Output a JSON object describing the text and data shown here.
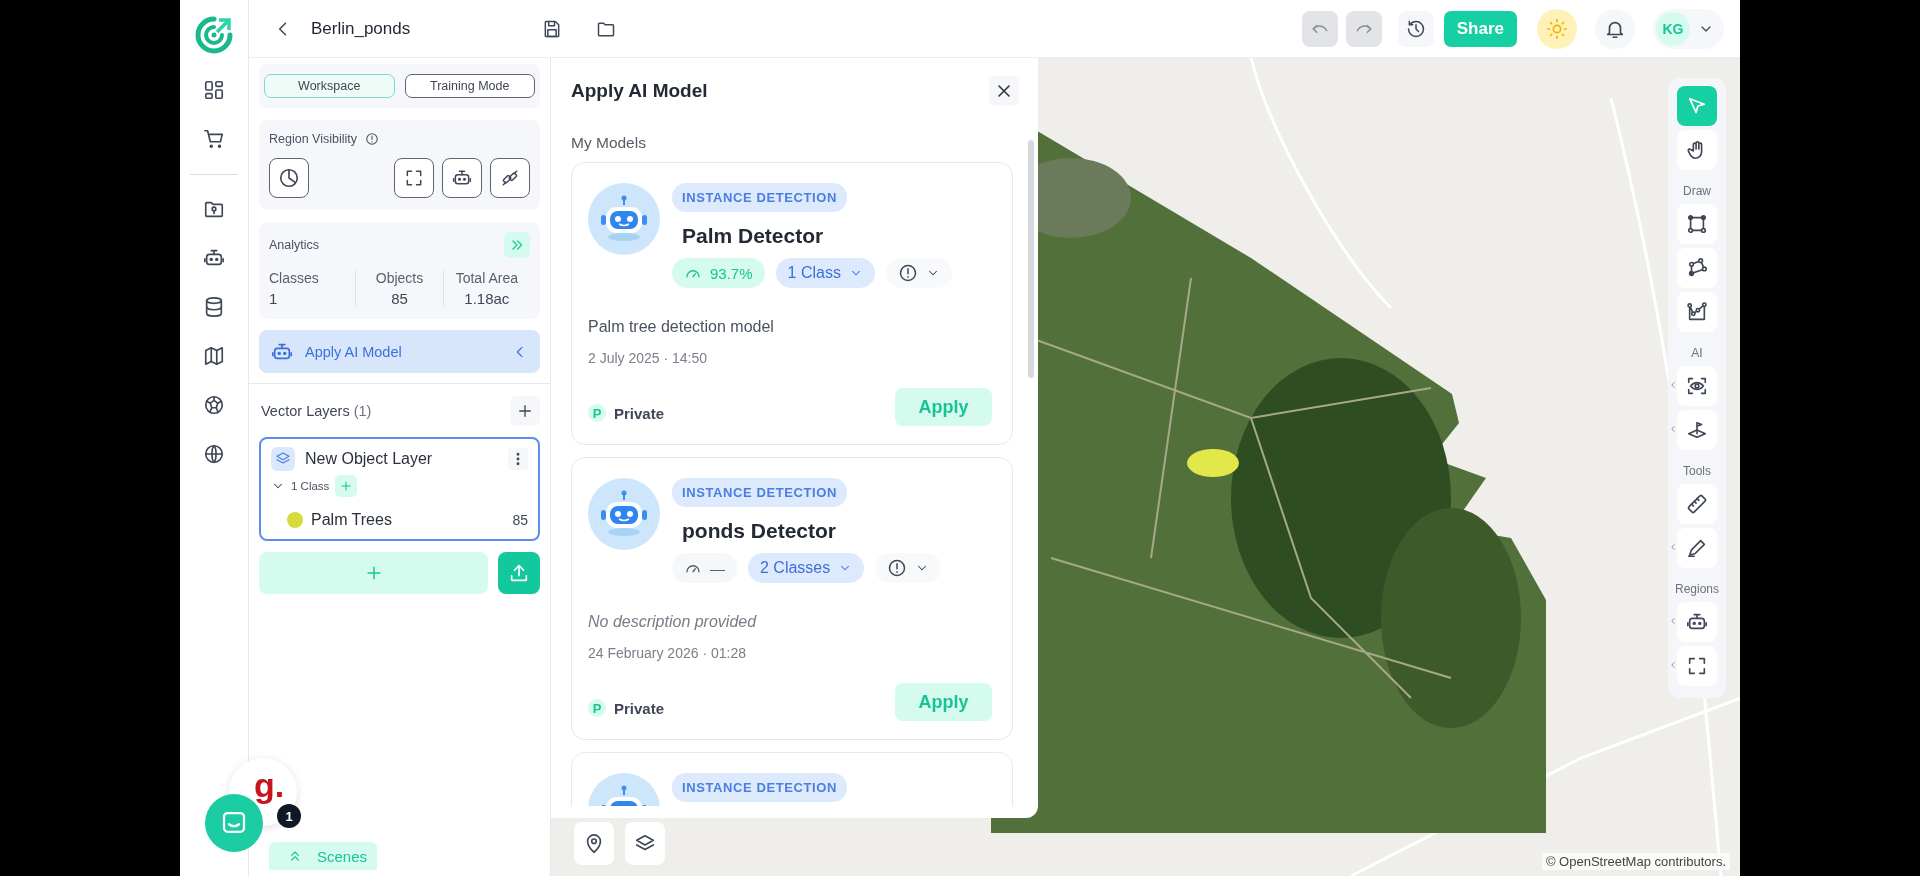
{
  "top_bar": {
    "project_title": "Berlin_ponds",
    "undo": {
      "disabled": true
    },
    "redo": {
      "disabled": true
    },
    "share_label": "Share",
    "user_initials": "KG"
  },
  "side_panel": {
    "modes": [
      {
        "label": "Workspace",
        "selected": true
      },
      {
        "label": "Training Mode",
        "selected": false
      }
    ],
    "region_visibility": {
      "title": "Region Visibility"
    },
    "analytics": {
      "title": "Analytics",
      "stats": [
        {
          "label": "Classes",
          "value": "1"
        },
        {
          "label": "Objects",
          "value": "85"
        },
        {
          "label": "Total Area",
          "value": "1.18ac"
        }
      ]
    },
    "apply_ai_model": {
      "label": "Apply AI Model",
      "selected": true
    },
    "vector_layers": {
      "title": "Vector Layers",
      "count": "(1)",
      "layers": [
        {
          "name": "New Object Layer",
          "selected": true,
          "class_count": "1 Class",
          "expanded": true,
          "classes": [
            {
              "name": "Palm Trees",
              "count": "85",
              "color": "#d6dc3c"
            }
          ]
        }
      ]
    },
    "scenes_label": "Scenes"
  },
  "chat_widget": {
    "logo_text": "g.",
    "badge": "1"
  },
  "models_panel": {
    "title": "Apply AI Model",
    "section_title": "My Models",
    "models": [
      {
        "type": "INSTANCE DETECTION",
        "name": "Palm Detector",
        "accuracy": "93.7%",
        "accuracy_known": true,
        "classes": "1 Class",
        "description": "Palm tree detection model",
        "description_missing": false,
        "date": "2 July 2025 · 14:50",
        "visibility_initial": "P",
        "visibility": "Private",
        "apply_label": "Apply"
      },
      {
        "type": "INSTANCE DETECTION",
        "name": "ponds Detector",
        "accuracy": "—",
        "accuracy_known": false,
        "classes": "2 Classes",
        "description": "No description provided",
        "description_missing": true,
        "date": "24 February 2026 · 01:28",
        "visibility_initial": "P",
        "visibility": "Private",
        "apply_label": "Apply"
      },
      {
        "type": "INSTANCE DETECTION"
      }
    ]
  },
  "map": {
    "attribution": "© OpenStreetMap contributors.",
    "toolbar": {
      "sections": [
        {
          "tools": [
            {
              "selected": true,
              "has_submenu": false
            },
            {
              "selected": false,
              "has_submenu": false
            }
          ]
        },
        {
          "heading": "Draw",
          "tools": [
            {
              "selected": false,
              "has_submenu": false
            },
            {
              "selected": false,
              "has_submenu": false
            },
            {
              "selected": false,
              "has_submenu": false
            }
          ]
        },
        {
          "heading": "AI",
          "tools": [
            {
              "selected": false,
              "has_submenu": true
            },
            {
              "selected": false,
              "has_submenu": true
            }
          ]
        },
        {
          "heading": "Tools",
          "tools": [
            {
              "selected": false,
              "has_submenu": false
            },
            {
              "selected": false,
              "has_submenu": true
            }
          ]
        },
        {
          "heading": "Regions",
          "tools": [
            {
              "selected": false,
              "has_submenu": true
            },
            {
              "selected": false,
              "has_submenu": true
            }
          ]
        }
      ]
    }
  }
}
